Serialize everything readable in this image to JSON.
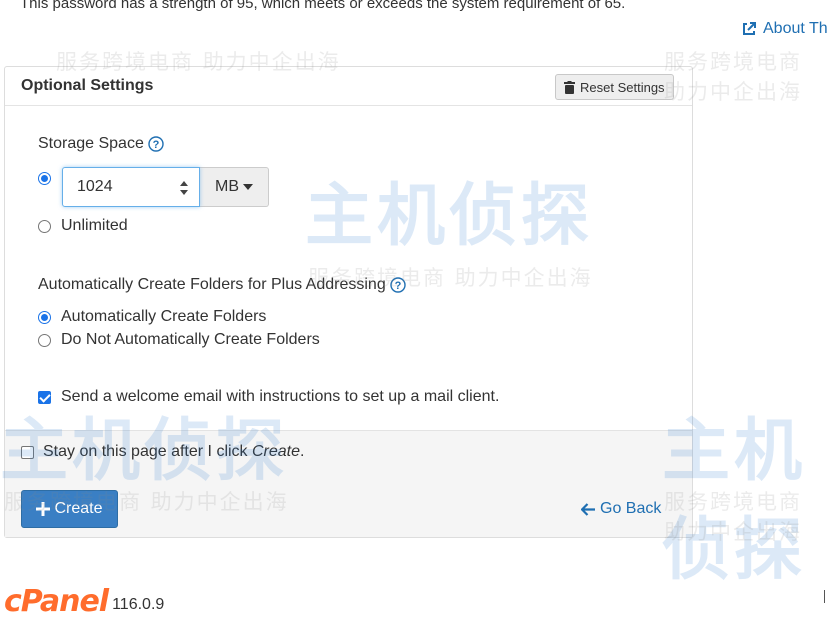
{
  "password_note": "This password has a strength of 95, which meets or exceeds the system requirement of 65.",
  "about_link": "About Th",
  "panel": {
    "title": "Optional Settings",
    "reset_label": "Reset Settings"
  },
  "storage": {
    "label": "Storage Space",
    "value": "1024",
    "unit": "MB",
    "unlimited_label": "Unlimited",
    "selected": "limited"
  },
  "plus_addressing": {
    "label": "Automatically Create Folders for Plus Addressing",
    "options": [
      {
        "label": "Automatically Create Folders",
        "checked": true
      },
      {
        "label": "Do Not Automatically Create Folders",
        "checked": false
      }
    ]
  },
  "welcome_email": {
    "label": "Send a welcome email with instructions to set up a mail client.",
    "checked": true
  },
  "footer": {
    "stay_label_prefix": "Stay on this page after I click ",
    "stay_label_em": "Create",
    "stay_label_suffix": ".",
    "stay_checked": false,
    "create_label": "Create",
    "go_back_label": "Go Back"
  },
  "brand": {
    "logo": "cPanel",
    "version": "116.0.9"
  },
  "watermark": {
    "big": "主机侦探",
    "small": "服务跨境电商  助力中企出海"
  },
  "colors": {
    "link": "#1f6fb2",
    "primary": "#3a7fc4",
    "brand_orange": "#ff6c2c"
  }
}
